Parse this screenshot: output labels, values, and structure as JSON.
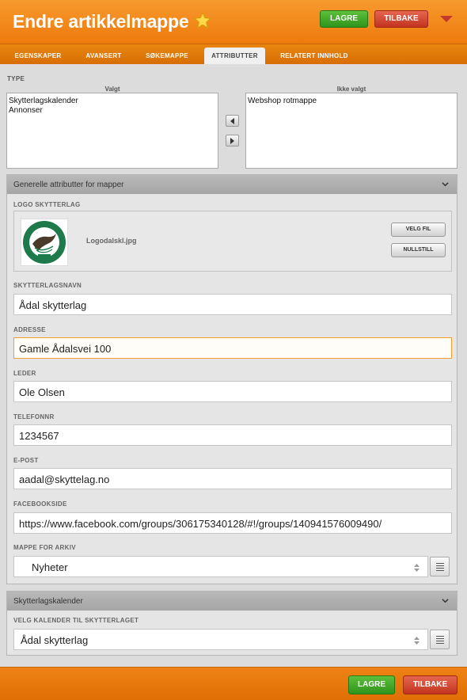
{
  "header": {
    "title": "Endre artikkelmappe",
    "save_label": "LAGRE",
    "back_label": "TILBAKE",
    "accent": "#ee7a0c"
  },
  "tabs": [
    {
      "label": "EGENSKAPER",
      "active": false
    },
    {
      "label": "AVANSERT",
      "active": false
    },
    {
      "label": "SØKEMAPPE",
      "active": false
    },
    {
      "label": "ATTRIBUTTER",
      "active": true
    },
    {
      "label": "RELATERT INNHOLD",
      "active": false
    }
  ],
  "type_section": {
    "label": "TYPE",
    "selected_label": "Valgt",
    "unselected_label": "Ikke valgt",
    "selected_items": [
      "Skytterlagskalender",
      "Annonser"
    ],
    "unselected_items": [
      "Webshop rotmappe"
    ]
  },
  "general_panel": {
    "title": "Generelle attributter for mapper",
    "logo": {
      "label": "LOGO SKYTTERLAG",
      "filename": "Logodalskl.jpg",
      "choose_file_label": "VELG FIL",
      "reset_label": "NULLSTILL",
      "logo_text_top": "ÅDAL SKYTTERLAG",
      "logo_text_year": "1890"
    },
    "fields": {
      "name": {
        "label": "SKYTTERLAGSNAVN",
        "value": "Ådal skytterlag"
      },
      "address": {
        "label": "ADRESSE",
        "value": "Gamle Ådalsvei 100"
      },
      "leader": {
        "label": "LEDER",
        "value": "Ole Olsen"
      },
      "phone": {
        "label": "TELEFONNR",
        "value": "1234567"
      },
      "email": {
        "label": "E-POST",
        "value": "aadal@skyttelag.no"
      },
      "facebook": {
        "label": "FACEBOOKSIDE",
        "value": "https://www.facebook.com/groups/306175340128/#!/groups/140941576009490/"
      }
    },
    "archive": {
      "label": "MAPPE FOR ARKIV",
      "value": "Nyheter"
    }
  },
  "calendar_panel": {
    "title": "Skytterlagskalender",
    "label": "VELG KALENDER TIL SKYTTERLAGET",
    "value": "Ådal skytterlag"
  },
  "footer": {
    "save_label": "LAGRE",
    "back_label": "TILBAKE"
  },
  "icons": {
    "star": "star-icon",
    "chevron": "chevron-down-icon",
    "list": "list-icon"
  }
}
